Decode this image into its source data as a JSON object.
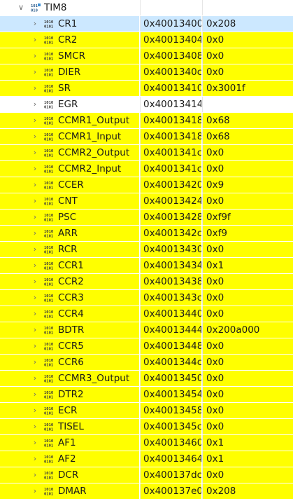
{
  "peripheral": {
    "name": "TIM8",
    "icon": "peripheral-icon"
  },
  "colors": {
    "changed_highlight": "#ffff00",
    "selection": "#cce8ff"
  },
  "registers": [
    {
      "name": "CR1",
      "address": "0x40013400",
      "value": "0x208",
      "state": "selected"
    },
    {
      "name": "CR2",
      "address": "0x40013404",
      "value": "0x0",
      "state": "yellow"
    },
    {
      "name": "SMCR",
      "address": "0x40013408",
      "value": "0x0",
      "state": "yellow"
    },
    {
      "name": "DIER",
      "address": "0x4001340c",
      "value": "0x0",
      "state": "yellow"
    },
    {
      "name": "SR",
      "address": "0x40013410",
      "value": "0x3001f",
      "state": "yellow"
    },
    {
      "name": "EGR",
      "address": "0x40013414",
      "value": "",
      "state": "white"
    },
    {
      "name": "CCMR1_Output",
      "address": "0x40013418",
      "value": "0x68",
      "state": "yellow"
    },
    {
      "name": "CCMR1_Input",
      "address": "0x40013418",
      "value": "0x68",
      "state": "yellow"
    },
    {
      "name": "CCMR2_Output",
      "address": "0x4001341c",
      "value": "0x0",
      "state": "yellow"
    },
    {
      "name": "CCMR2_Input",
      "address": "0x4001341c",
      "value": "0x0",
      "state": "yellow"
    },
    {
      "name": "CCER",
      "address": "0x40013420",
      "value": "0x9",
      "state": "yellow"
    },
    {
      "name": "CNT",
      "address": "0x40013424",
      "value": "0x0",
      "state": "yellow"
    },
    {
      "name": "PSC",
      "address": "0x40013428",
      "value": "0xf9f",
      "state": "yellow"
    },
    {
      "name": "ARR",
      "address": "0x4001342c",
      "value": "0xf9",
      "state": "yellow"
    },
    {
      "name": "RCR",
      "address": "0x40013430",
      "value": "0x0",
      "state": "yellow"
    },
    {
      "name": "CCR1",
      "address": "0x40013434",
      "value": "0x1",
      "state": "yellow"
    },
    {
      "name": "CCR2",
      "address": "0x40013438",
      "value": "0x0",
      "state": "yellow"
    },
    {
      "name": "CCR3",
      "address": "0x4001343c",
      "value": "0x0",
      "state": "yellow"
    },
    {
      "name": "CCR4",
      "address": "0x40013440",
      "value": "0x0",
      "state": "yellow"
    },
    {
      "name": "BDTR",
      "address": "0x40013444",
      "value": "0x200a000",
      "state": "yellow"
    },
    {
      "name": "CCR5",
      "address": "0x40013448",
      "value": "0x0",
      "state": "yellow"
    },
    {
      "name": "CCR6",
      "address": "0x4001344c",
      "value": "0x0",
      "state": "yellow"
    },
    {
      "name": "CCMR3_Output",
      "address": "0x40013450",
      "value": "0x0",
      "state": "yellow"
    },
    {
      "name": "DTR2",
      "address": "0x40013454",
      "value": "0x0",
      "state": "yellow"
    },
    {
      "name": "ECR",
      "address": "0x40013458",
      "value": "0x0",
      "state": "yellow"
    },
    {
      "name": "TISEL",
      "address": "0x4001345c",
      "value": "0x0",
      "state": "yellow"
    },
    {
      "name": "AF1",
      "address": "0x40013460",
      "value": "0x1",
      "state": "yellow"
    },
    {
      "name": "AF2",
      "address": "0x40013464",
      "value": "0x1",
      "state": "yellow"
    },
    {
      "name": "DCR",
      "address": "0x400137dc",
      "value": "0x0",
      "state": "yellow"
    },
    {
      "name": "DMAR",
      "address": "0x400137e0",
      "value": "0x208",
      "state": "yellow"
    }
  ]
}
